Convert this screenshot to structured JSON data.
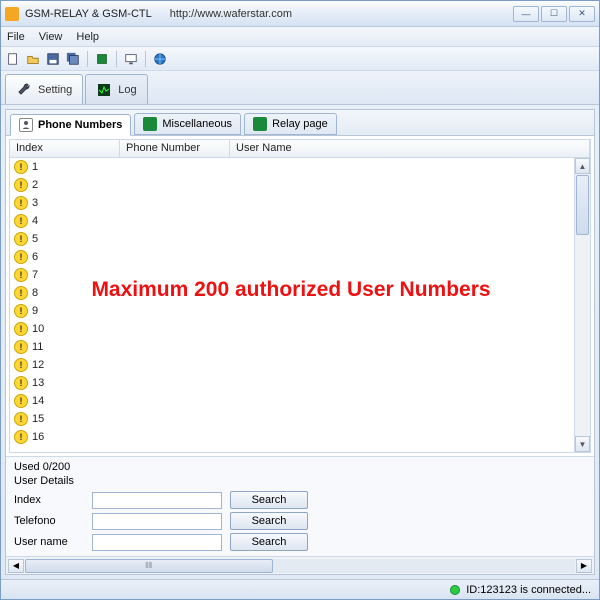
{
  "window": {
    "title": "GSM-RELAY & GSM-CTL",
    "url": "http://www.waferstar.com"
  },
  "menu": {
    "file": "File",
    "view": "View",
    "help": "Help"
  },
  "bigtabs": {
    "setting": "Setting",
    "log": "Log"
  },
  "subtabs": {
    "phone": "Phone Numbers",
    "misc": "Miscellaneous",
    "relay": "Relay page"
  },
  "columns": {
    "index": "Index",
    "phone": "Phone Number",
    "user": "User Name"
  },
  "rows": [
    {
      "n": "1"
    },
    {
      "n": "2"
    },
    {
      "n": "3"
    },
    {
      "n": "4"
    },
    {
      "n": "5"
    },
    {
      "n": "6"
    },
    {
      "n": "7"
    },
    {
      "n": "8"
    },
    {
      "n": "9"
    },
    {
      "n": "10"
    },
    {
      "n": "11"
    },
    {
      "n": "12"
    },
    {
      "n": "13"
    },
    {
      "n": "14"
    },
    {
      "n": "15"
    },
    {
      "n": "16"
    }
  ],
  "overlay": "Maximum 200 authorized User Numbers",
  "details": {
    "used": "Used 0/200",
    "header": "User Details",
    "index_lbl": "Index",
    "tel_lbl": "Telefono",
    "user_lbl": "User name",
    "search": "Search"
  },
  "status": {
    "text": "ID:123123 is connected..."
  },
  "hscroll_grip": "⦀⦀"
}
